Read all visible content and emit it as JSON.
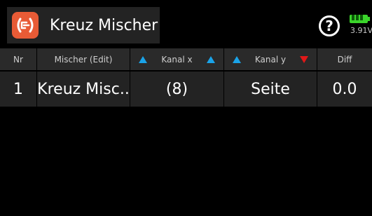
{
  "header": {
    "title": "Kreuz Mischer",
    "app_icon": "cross-mixer-icon",
    "help_symbol": "?",
    "battery_voltage": "3.91V",
    "battery_level": 1.0
  },
  "table": {
    "columns": {
      "nr": "Nr",
      "mixer": "Mischer (Edit)",
      "kanal_x": "Kanal x",
      "kanal_y": "Kanal y",
      "diff": "Diff"
    },
    "rows": [
      {
        "nr": "1",
        "mixer": "Kreuz Misc..",
        "kanal_x": "(8)",
        "kanal_y": "Seite",
        "diff": "0.0"
      }
    ]
  },
  "colors": {
    "accent_orange": "#e85b36",
    "arrow_blue": "#1aa3e8",
    "arrow_red": "#e01818",
    "battery_green": "#3bd52b",
    "header_bg": "#2a2a2a",
    "row_bg": "#232323"
  }
}
